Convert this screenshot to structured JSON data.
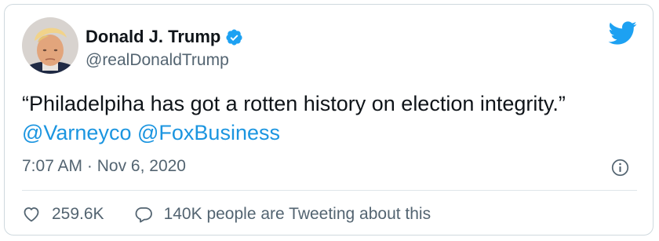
{
  "tweet": {
    "author_name": "Donald J. Trump",
    "handle": "@realDonaldTrump",
    "text_prefix": "“Philadelpiha has got a rotten history on election integrity.” ",
    "mention_1": "@Varneyco",
    "mention_2": "@FoxBusiness",
    "time": "7:07 AM",
    "separator": " · ",
    "date": "Nov 6, 2020",
    "likes": "259.6K",
    "tweeting_text": "140K people are Tweeting about this",
    "verified_icon": "verified-badge-icon",
    "platform_icon": "twitter-bird-icon"
  },
  "colors": {
    "brand": "#1da1f2",
    "mention": "#1b95e0",
    "text": "#0f1419",
    "secondary": "#536471",
    "border": "#cfd9de"
  }
}
